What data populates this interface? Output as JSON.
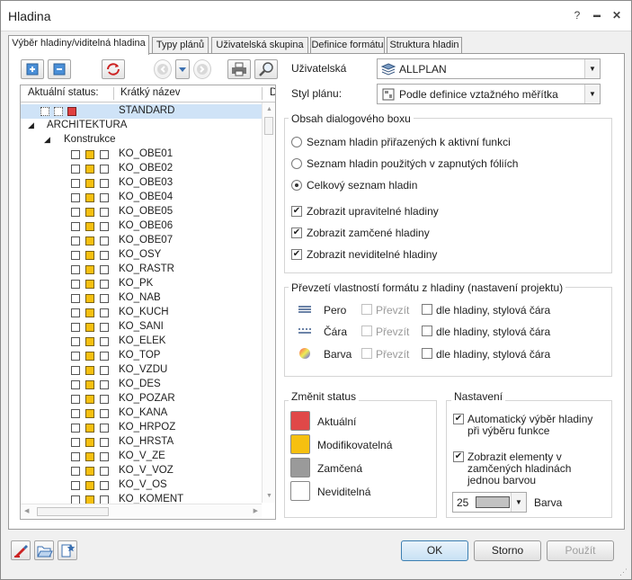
{
  "title": "Hladina",
  "window_buttons": {
    "help": "?",
    "minimize": "▬",
    "maximize": "□",
    "close": "✕"
  },
  "tabs": [
    "Výběr hladiny/viditelná hladina",
    "Typy plánů",
    "Uživatelská skupina",
    "Definice formátu",
    "Struktura hladin"
  ],
  "toolbar_icons": [
    "add-icon",
    "remove-icon",
    "refresh-icon",
    "back-icon",
    "dropdown-icon",
    "forward-icon",
    "print-icon",
    "search-icon"
  ],
  "tree": {
    "headers": [
      "Aktuální status:",
      "Krátký název",
      "D"
    ],
    "standard": "STANDARD",
    "root": "ARCHITEKTURA",
    "group": "Konstrukce",
    "items": [
      "KO_OBE01",
      "KO_OBE02",
      "KO_OBE03",
      "KO_OBE04",
      "KO_OBE05",
      "KO_OBE06",
      "KO_OBE07",
      "KO_OSY",
      "KO_RASTR",
      "KO_PK",
      "KO_NAB",
      "KO_KUCH",
      "KO_SANI",
      "KO_ELEK",
      "KO_TOP",
      "KO_VZDU",
      "KO_DES",
      "KO_POZAR",
      "KO_KANA",
      "KO_HRPOZ",
      "KO_HRSTA",
      "KO_V_ZE",
      "KO_V_VOZ",
      "KO_V_OS",
      "KO_KOMENT"
    ]
  },
  "user_label": "Uživatelská",
  "user_value": "ALLPLAN",
  "style_label": "Styl plánu:",
  "style_value": "Podle definice vztažného měřítka",
  "content_group": {
    "label": "Obsah dialogového boxu",
    "radios": [
      "Seznam hladin přiřazených k aktivní funkci",
      "Seznam hladin použitých v zapnutých fóliích",
      "Celkový seznam hladin"
    ],
    "selected": 2,
    "checks": [
      "Zobrazit upravitelné hladiny",
      "Zobrazit zamčené hladiny",
      "Zobrazit neviditelné hladiny"
    ]
  },
  "format_group": {
    "label": "Převzetí vlastností formátu z hladiny (nastavení projektu)",
    "rows": [
      {
        "name": "Pero",
        "take": "Převzít",
        "by_layer": "dle hladiny, stylová čára"
      },
      {
        "name": "Čára",
        "take": "Převzít",
        "by_layer": "dle hladiny, stylová čára"
      },
      {
        "name": "Barva",
        "take": "Převzít",
        "by_layer": "dle hladiny, stylová čára"
      }
    ]
  },
  "status_group": {
    "label": "Změnit status",
    "items": [
      {
        "label": "Aktuální",
        "color": "#e04848"
      },
      {
        "label": "Modifikovatelná",
        "color": "#f6c010"
      },
      {
        "label": "Zamčená",
        "color": "#9a9a9a"
      },
      {
        "label": "Neviditelná",
        "color": "#ffffff"
      }
    ]
  },
  "settings_group": {
    "label": "Nastavení",
    "auto_select_1": "Automatický výběr hladiny",
    "auto_select_2": "při výběru funkce",
    "show_locked_1": "Zobrazit elementy v",
    "show_locked_2": "zamčených hladinách",
    "show_locked_3": "jednou barvou",
    "color_number": "25",
    "color_label": "Barva"
  },
  "bottom_icons": [
    "brush-icon",
    "open-folder-icon",
    "favorite-icon"
  ],
  "buttons": {
    "ok": "OK",
    "cancel": "Storno",
    "apply": "Použít"
  }
}
